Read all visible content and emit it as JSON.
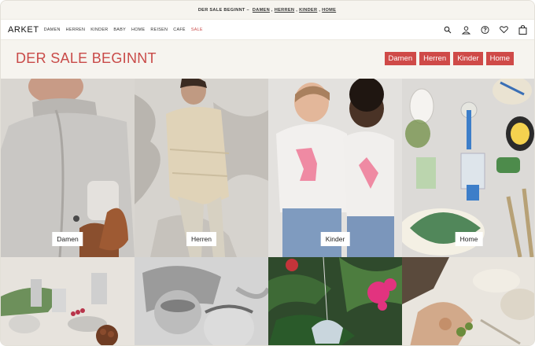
{
  "announcement": {
    "lead": "DER SALE BEGINNT –",
    "links": [
      "DAMEN",
      "HERREN",
      "KINDER",
      "HOME"
    ]
  },
  "header": {
    "logo": "ARKET",
    "nav": [
      "DAMEN",
      "HERREN",
      "KINDER",
      "BABY",
      "HOME",
      "REISEN",
      "CAFÉ",
      "SALE"
    ],
    "icons": [
      "search-icon",
      "account-icon",
      "help-icon",
      "wishlist-icon",
      "bag-icon"
    ]
  },
  "hero": {
    "title": "DER SALE BEGINNT",
    "buttons": [
      "Damen",
      "Herren",
      "Kinder",
      "Home"
    ]
  },
  "tiles": [
    {
      "label": "Damen"
    },
    {
      "label": "Herren"
    },
    {
      "label": "Kinder"
    },
    {
      "label": "Home"
    }
  ],
  "colors": {
    "accent": "#c94a48",
    "background": "#f6f4ef"
  }
}
